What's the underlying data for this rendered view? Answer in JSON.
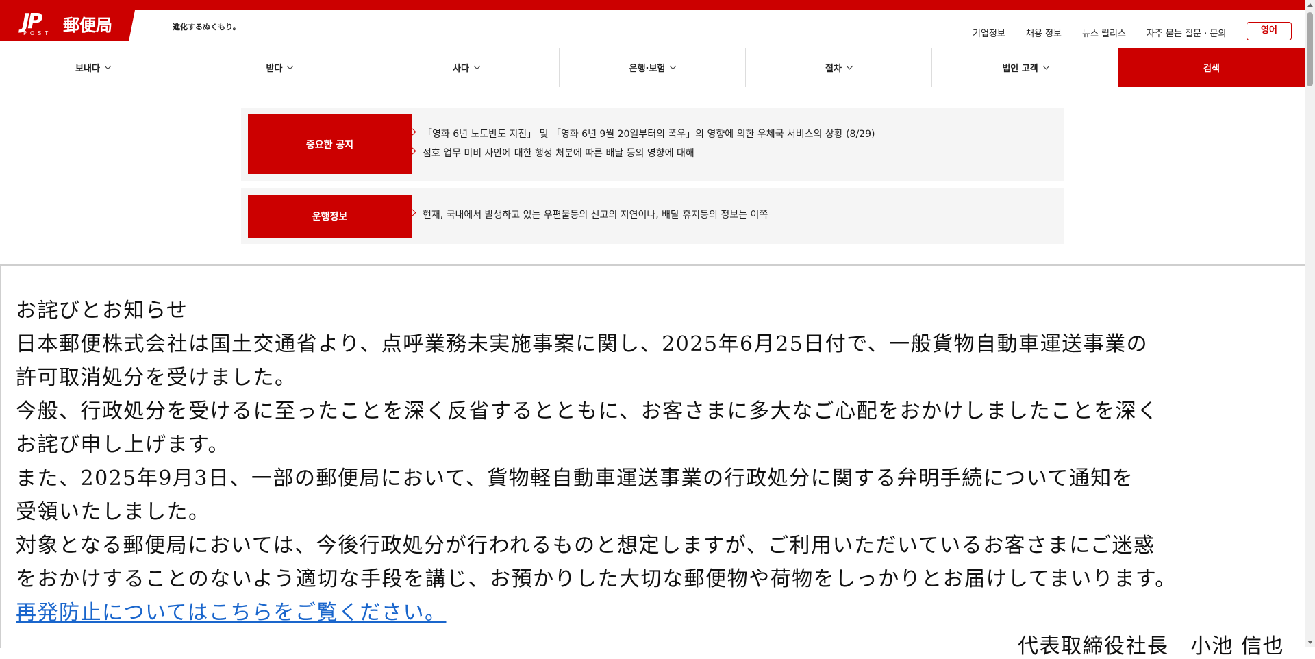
{
  "header": {
    "logo_mark": "JP",
    "logo_post": "POST",
    "logo_text": "郵便局",
    "tagline": "進化するぬくもり。",
    "utility_links": [
      "기업정보",
      "채용 정보",
      "뉴스 릴리스",
      "자주 묻는 질문 · 문의"
    ],
    "language_button": "영어",
    "brand_color": "#cc0000"
  },
  "nav": {
    "items": [
      "보내다",
      "받다",
      "사다",
      "은행·보험",
      "절차",
      "법인 고객"
    ],
    "search_label": "검색"
  },
  "notices": {
    "important_label": "중요한 공지",
    "important_items": [
      "「영화 6년 노토반도 지진」 및 「영화 6년 9월 20일부터의 폭우」의 영향에 의한 우체국 서비스의 상황 (8/29)",
      "점호 업무 미비 사안에 대한 행정 처분에 따른 배달 등의 영향에 대해"
    ],
    "operation_label": "운행정보",
    "operation_items": [
      "현재, 국내에서 발생하고 있는 우편물등의 신고의 지연이나, 배달 휴지등의 정보는 이쪽"
    ]
  },
  "apology": {
    "title": "お詫びとお知らせ",
    "lines": [
      "日本郵便株式会社は国土交通省より、点呼業務未実施事案に関し、2025年6月25日付で、一般貨物自動車運送事業の",
      "許可取消処分を受けました。",
      "今般、行政処分を受けるに至ったことを深く反省するとともに、お客さまに多大なご心配をおかけしましたことを深く",
      "お詫び申し上げます。",
      "また、2025年9月3日、一部の郵便局において、貨物軽自動車運送事業の行政処分に関する弁明手続について通知を",
      "受領いたしました。",
      "対象となる郵便局においては、今後行政処分が行われるものと想定しますが、ご利用いただいているお客さまにご迷惑",
      "をおかけすることのないよう適切な手段を講じ、お預かりした大切な郵便物や荷物をしっかりとお届けしてまいります。"
    ],
    "link": "再発防止についてはこちらをご覧ください。",
    "signature": "代表取締役社長　小池 信也"
  }
}
